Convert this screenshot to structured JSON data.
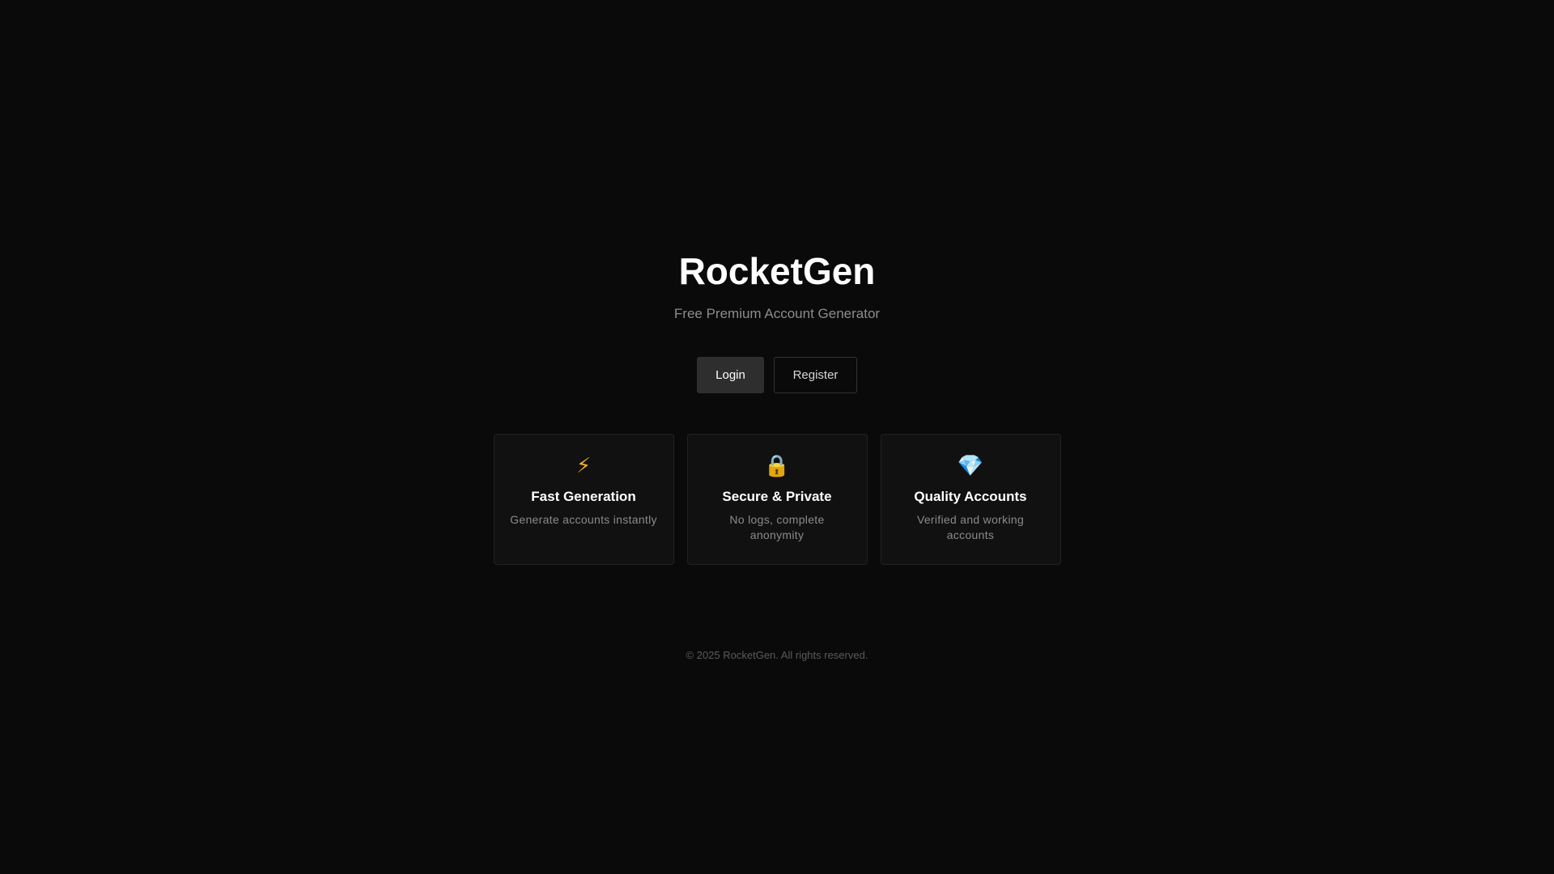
{
  "hero": {
    "title": "RocketGen",
    "subtitle": "Free Premium Account Generator"
  },
  "actions": {
    "login_label": "Login",
    "register_label": "Register"
  },
  "features": [
    {
      "icon": "lightning-bolt-icon",
      "glyph": "⚡",
      "title": "Fast Generation",
      "description": "Generate accounts instantly"
    },
    {
      "icon": "lock-icon",
      "glyph": "🔒",
      "title": "Secure & Private",
      "description": "No logs, complete anonymity"
    },
    {
      "icon": "gem-icon",
      "glyph": "💎",
      "title": "Quality Accounts",
      "description": "Verified and working accounts"
    }
  ],
  "footer": {
    "copyright": "© 2025 RocketGen. All rights reserved."
  },
  "colors": {
    "background": "#0a0a0a",
    "card_background": "#111111",
    "card_border": "#222222",
    "login_button": "#2e2e2e",
    "subtitle_text": "#8c8c8c",
    "footer_text": "#5a5a5a"
  }
}
